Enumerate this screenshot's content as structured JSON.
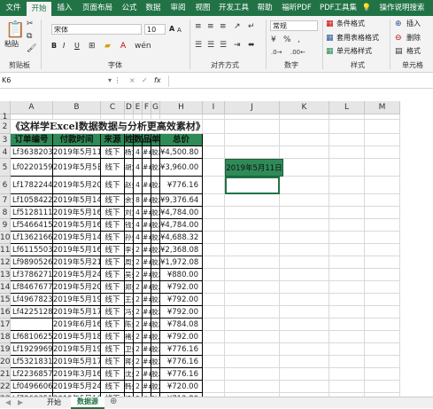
{
  "tabs": [
    "文件",
    "开始",
    "插入",
    "页面布局",
    "公式",
    "数据",
    "审阅",
    "视图",
    "开发工具",
    "帮助",
    "福昕PDF",
    "PDF工具集",
    "操作说明搜索"
  ],
  "ribbon": {
    "paste": "粘贴",
    "clipboard": "剪贴板",
    "font_name": "宋体",
    "font_size": "10",
    "font_group": "字体",
    "align_group": "对齐方式",
    "number_format": "常规",
    "number_group": "数字",
    "cond_format": "条件格式",
    "table_format": "套用表格格式",
    "cell_style": "单元格样式",
    "style_group": "样式",
    "insert": "插入",
    "delete": "删除",
    "format": "格式",
    "cells_group": "单元格",
    "bold": "B",
    "italic": "I",
    "underline": "U",
    "grow_a": "A",
    "shrink_a": "A"
  },
  "formula_bar": {
    "name_box": "K6",
    "cancel": "×",
    "enter": "✓",
    "fx": "fx",
    "value": ""
  },
  "columns": [
    "A",
    "B",
    "C",
    "D",
    "E",
    "F",
    "G",
    "H",
    "I",
    "J",
    "K",
    "L",
    "M"
  ],
  "sheet": {
    "title": "《这样学Excel数据数据与分析更高效素材》",
    "headers": [
      "订单编号",
      "付款时间",
      "来源",
      "姓名",
      "数量",
      "品名",
      "单价",
      "总价"
    ],
    "highlight": "2019年5月11日",
    "rows": [
      {
        "r": "4",
        "a": "Lf3638203",
        "b": "2019年5月11日",
        "c": "线下",
        "d": "杨女",
        "e": "4",
        "f": "##",
        "g": "胶发",
        "h": "¥4,500.80"
      },
      {
        "r": "5",
        "a": "Lf0220159",
        "b": "2019年5月5日",
        "c": "线下",
        "d": "胡女",
        "e": "4",
        "f": "##",
        "g": "胶发",
        "h": "¥3,960.00"
      },
      {
        "r": "6",
        "a": "Lf1782244",
        "b": "2019年5月20日",
        "c": "线下",
        "d": "赵先",
        "e": "4",
        "f": "##",
        "g": "胶发",
        "h": "¥776.16"
      },
      {
        "r": "7",
        "a": "Lf1058422",
        "b": "2019年5月14日",
        "c": "线下",
        "d": "余女",
        "e": "8",
        "f": "##",
        "g": "胶发",
        "h": "¥9,376.64"
      },
      {
        "r": "8",
        "a": "Lf5128111",
        "b": "2019年5月16日",
        "c": "线下",
        "d": "刘女",
        "e": "4",
        "f": "##",
        "g": "胶发",
        "h": "¥4,784.00"
      },
      {
        "r": "9",
        "a": "Lf5466415",
        "b": "2019年5月16日",
        "c": "线下",
        "d": "钱女",
        "e": "4",
        "f": "##",
        "g": "胶发",
        "h": "¥4,784.00"
      },
      {
        "r": "10",
        "a": "Lf1362166",
        "b": "2019年5月14日",
        "c": "线下",
        "d": "孙先",
        "e": "4",
        "f": "##",
        "g": "胶发",
        "h": "¥4,688.32"
      },
      {
        "r": "11",
        "a": "Lf6115503",
        "b": "2019年5月16日",
        "c": "线下",
        "d": "李先",
        "e": "2",
        "f": "##",
        "g": "胶发",
        "h": "¥2,368.08"
      },
      {
        "r": "12",
        "a": "Lf9890526",
        "b": "2019年5月21日",
        "c": "线下",
        "d": "周女",
        "e": "2",
        "f": "##",
        "g": "胶发",
        "h": "¥1,972.08"
      },
      {
        "r": "13",
        "a": "Lf3786271",
        "b": "2019年5月24日",
        "c": "线下",
        "d": "吴先",
        "e": "2",
        "f": "##",
        "g": "胶发",
        "h": "¥880.00"
      },
      {
        "r": "14",
        "a": "Lf8467677",
        "b": "2019年5月20日",
        "c": "线下",
        "d": "郑先",
        "e": "2",
        "f": "##",
        "g": "胶发",
        "h": "¥792.00"
      },
      {
        "r": "15",
        "a": "Lf4967823",
        "b": "2019年5月19日",
        "c": "线下",
        "d": "王先",
        "e": "2",
        "f": "##",
        "g": "胶发",
        "h": "¥792.00"
      },
      {
        "r": "16",
        "a": "Lf4225128",
        "b": "2019年5月17日",
        "c": "线下",
        "d": "冯先",
        "e": "2",
        "f": "##",
        "g": "胶发",
        "h": "¥792.00"
      },
      {
        "r": "17",
        "a": "",
        "b": "2019年6月16日",
        "c": "线下",
        "d": "陈先",
        "e": "2",
        "f": "##",
        "g": "胶发",
        "h": "¥784.08"
      },
      {
        "r": "18",
        "a": "Lf6810625",
        "b": "2019年5月18日",
        "c": "线下",
        "d": "褚先",
        "e": "2",
        "f": "##",
        "g": "胶发",
        "h": "¥792.00"
      },
      {
        "r": "19",
        "a": "Lf1929969",
        "b": "2019年5月19日",
        "c": "线下",
        "d": "卫先",
        "e": "2",
        "f": "##",
        "g": "胶发",
        "h": "¥776.16"
      },
      {
        "r": "20",
        "a": "Lf5321831",
        "b": "2019年5月17日",
        "c": "线下",
        "d": "蒋先",
        "e": "2",
        "f": "##",
        "g": "胶发",
        "h": "¥776.16"
      },
      {
        "r": "21",
        "a": "Lf2236857",
        "b": "2019年3月16日",
        "c": "线下",
        "d": "沈先",
        "e": "2",
        "f": "##",
        "g": "胶发",
        "h": "¥776.16"
      },
      {
        "r": "22",
        "a": "Lf0496606",
        "b": "2019年5月24日",
        "c": "线下",
        "d": "韩先",
        "e": "2",
        "f": "##",
        "g": "胶发",
        "h": "¥720.00"
      },
      {
        "r": "23",
        "a": "Lf7260351",
        "b": "2019年5月10日",
        "c": "线下",
        "d": "杨先",
        "e": "2",
        "f": "##",
        "g": "胶发",
        "h": "¥712.80"
      }
    ]
  },
  "sheet_tabs": [
    "开始",
    "数据源"
  ],
  "active_sheet": "数据源"
}
